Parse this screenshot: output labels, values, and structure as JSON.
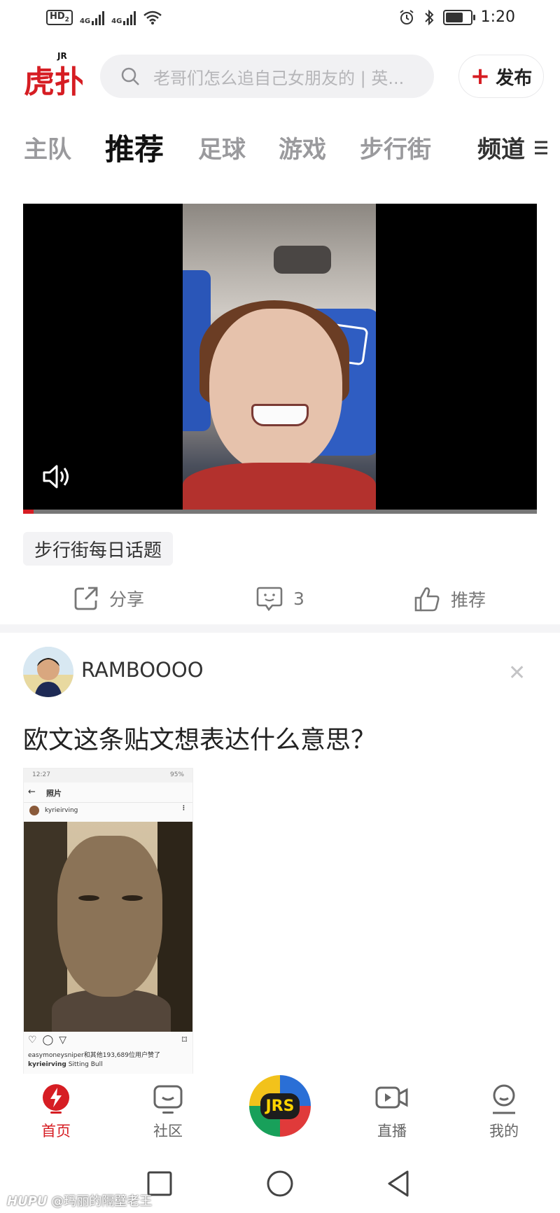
{
  "status_bar": {
    "hd": "HD",
    "hd_sub": "2",
    "net1": "4G",
    "net2": "4G",
    "time": "1:20",
    "battery_level": 0.8
  },
  "header": {
    "logo_text": "虎扑",
    "logo_badge": "JR",
    "search_placeholder": "老哥们怎么追自己女朋友的 | 英...",
    "publish_label": "发布",
    "brand_color": "#d61d23"
  },
  "tabs": {
    "items": [
      "主队",
      "推荐",
      "足球",
      "游戏",
      "步行街"
    ],
    "active_index": 1,
    "channel_label": "频道"
  },
  "post1": {
    "video_progress": 0.02,
    "topic_tag": "步行街每日话题",
    "share_label": "分享",
    "comment_count": "3",
    "recommend_label": "推荐"
  },
  "post2": {
    "author": "RAMBOOOO",
    "title": "欧文这条贴文想表达什么意思？",
    "screenshot": {
      "time": "12:27",
      "battery": "95%",
      "nav_title": "照片",
      "username": "kyrieirving",
      "likes_text": "easymoneysniper和其他193,689位用户赞了",
      "caption_user": "kyrieirving",
      "caption_text": "Sitting Bull"
    }
  },
  "bottom_tabs": {
    "home": "首页",
    "community": "社区",
    "center_badge": "JRS",
    "live": "直播",
    "mine": "我的"
  },
  "watermark": {
    "brand": "HUPU",
    "handle": "@玛丽的隔壁老王"
  }
}
